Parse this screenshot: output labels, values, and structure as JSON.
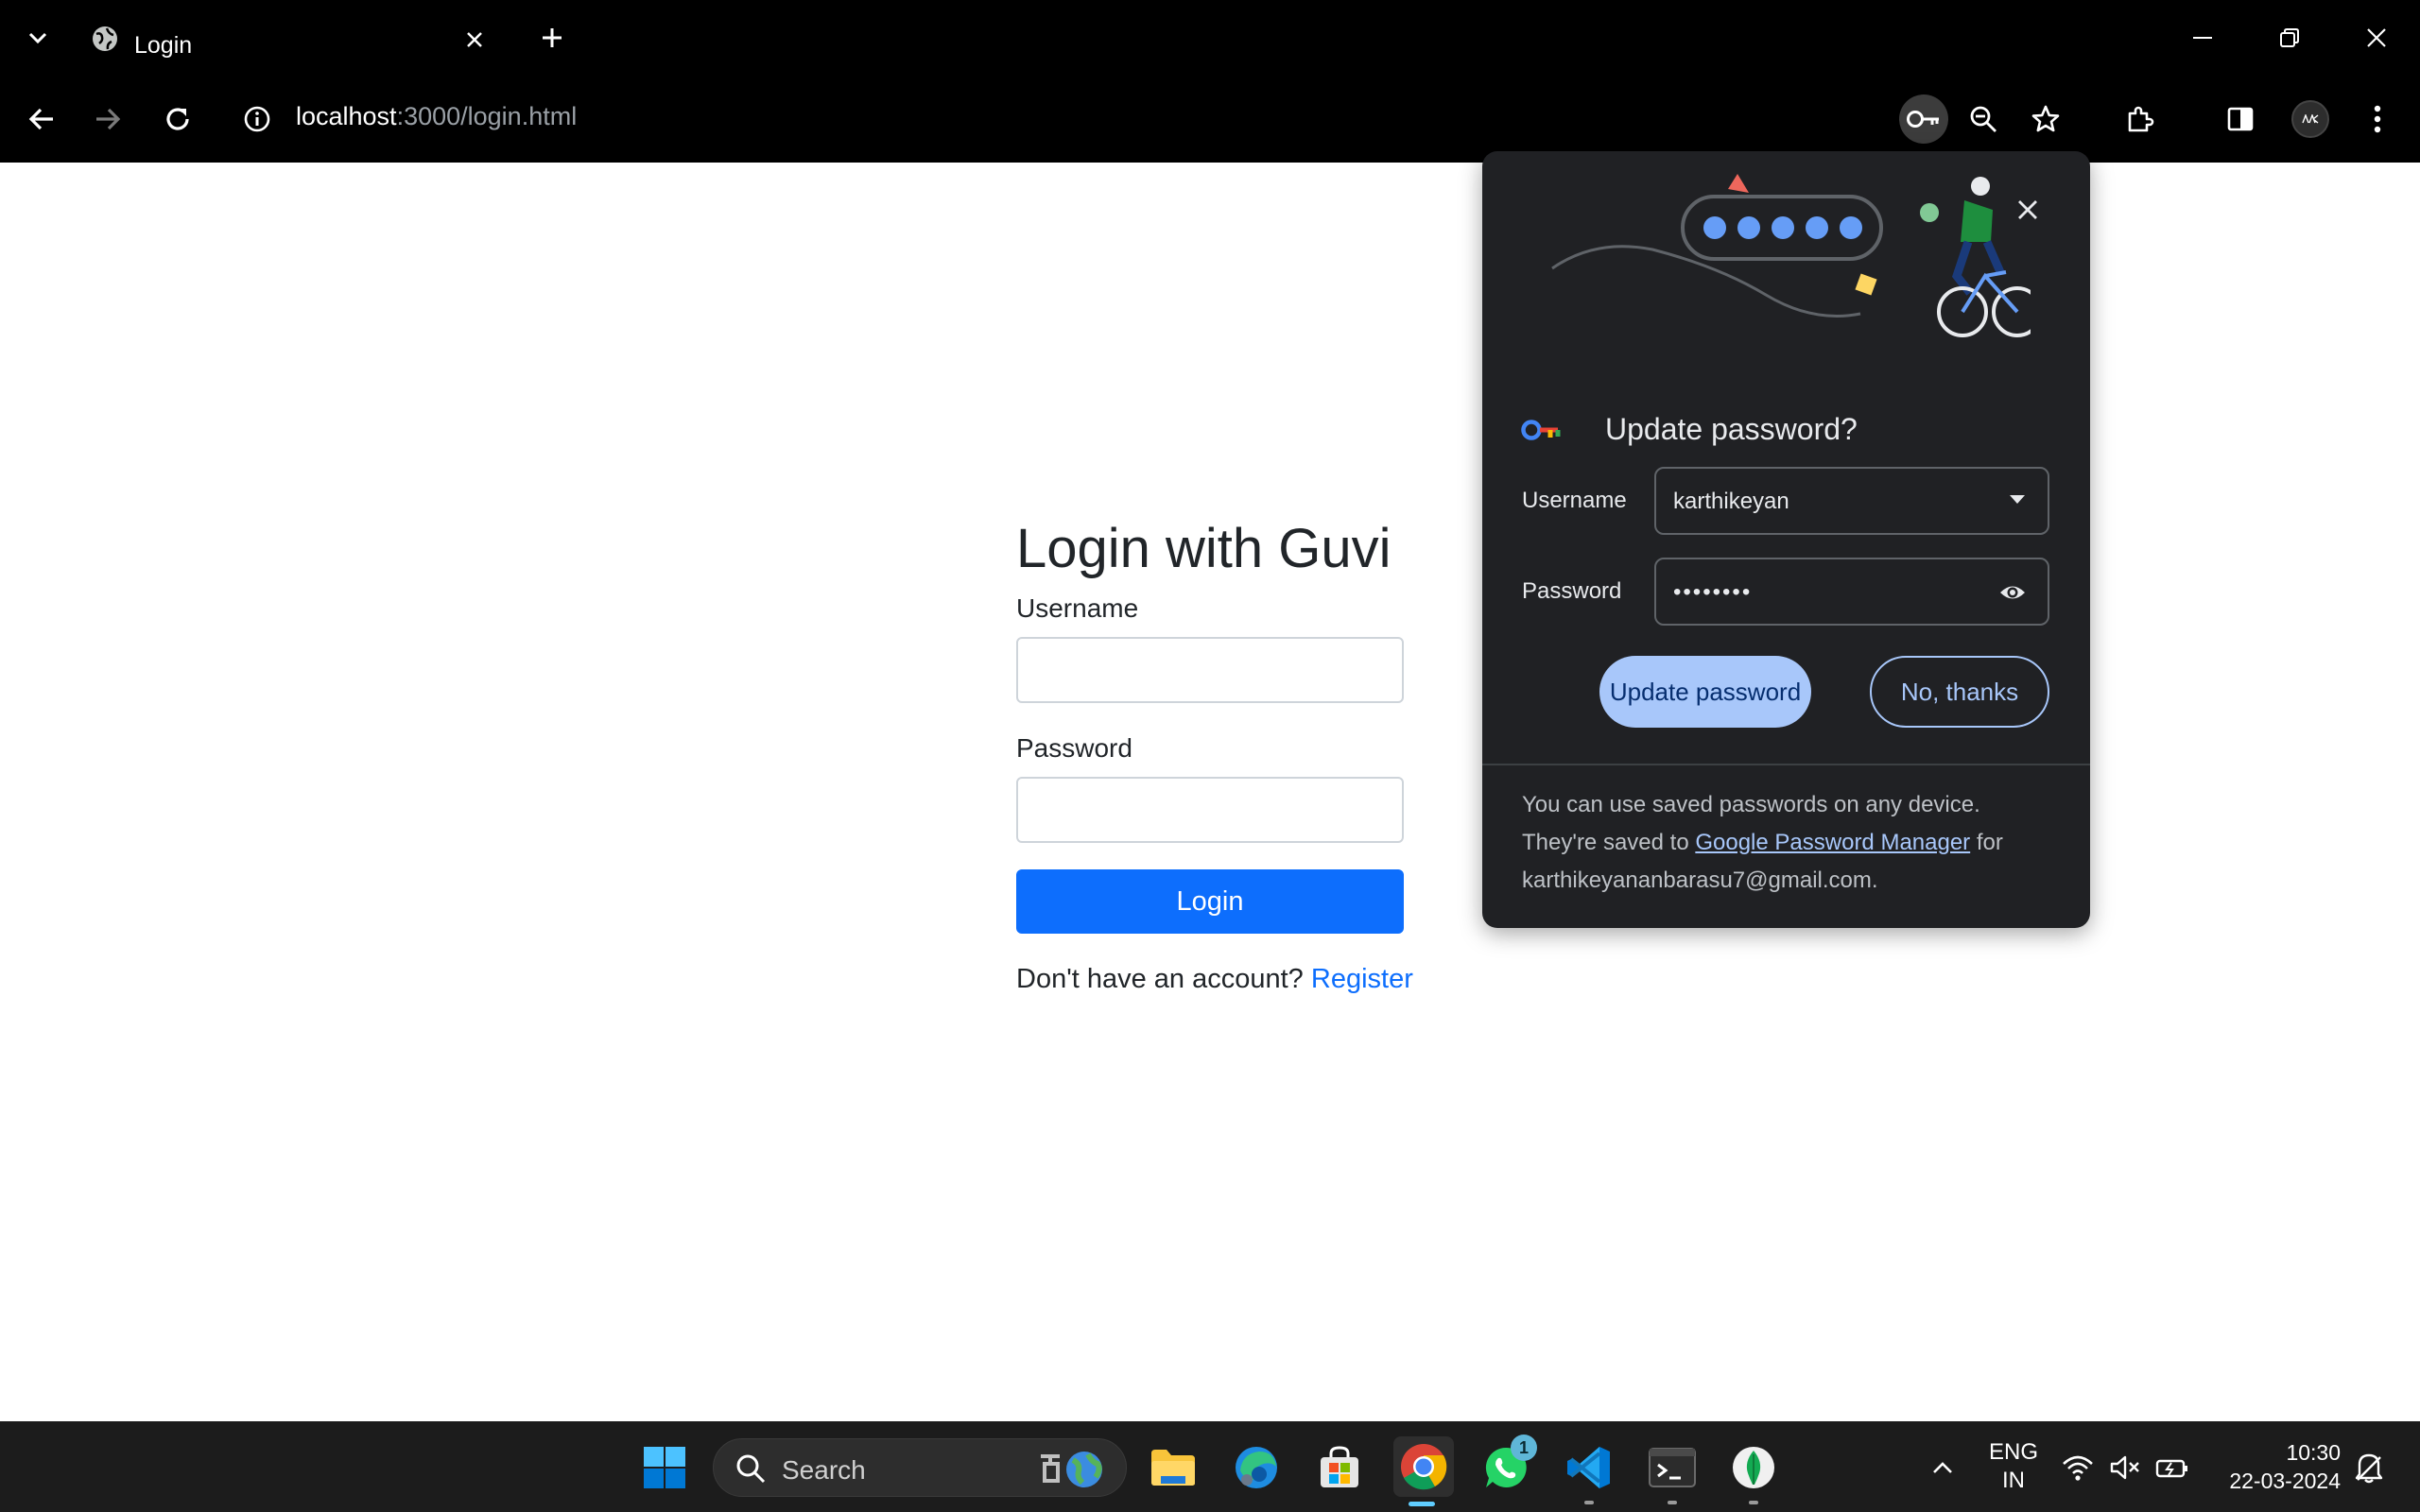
{
  "browser": {
    "tab": {
      "title": "Login"
    },
    "url": {
      "host": "localhost",
      "path": ":3000/login.html"
    }
  },
  "page": {
    "title": "Login with Guvi",
    "username_label": "Username",
    "username_value": "",
    "password_label": "Password",
    "password_value": "",
    "login_button": "Login",
    "no_account_text": "Don't have an account? ",
    "register_link": "Register"
  },
  "password_bubble": {
    "title": "Update password?",
    "username_label": "Username",
    "username_value": "karthikeyan",
    "password_label": "Password",
    "password_masked": "••••••••",
    "update_button": "Update password",
    "no_thanks_button": "No, thanks",
    "footer_before": "You can use saved passwords on any device. They're saved to ",
    "footer_link": "Google Password Manager",
    "footer_after": " for karthikeyananbarasu7@gmail.com."
  },
  "taskbar": {
    "search_label": "Search",
    "whatsapp_badge": "1",
    "lang_line1": "ENG",
    "lang_line2": "IN",
    "time": "10:30",
    "date": "22-03-2024"
  },
  "colors": {
    "primary_button": "#0d6efd",
    "bubble_background": "#202124",
    "bubble_accent": "#a8c7fa"
  }
}
